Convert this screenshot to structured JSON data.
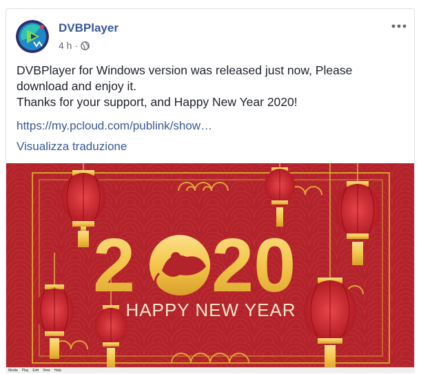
{
  "post": {
    "page_name": "DVBPlayer",
    "time": "4 h",
    "separator": "·",
    "privacy_icon": "globe-icon",
    "more_icon": "more-horizontal-icon",
    "text_lines": [
      "DVBPlayer for Windows version was released just now, Please",
      "download and enjoy it.",
      "Thanks for your support, and Happy New Year 2020!"
    ],
    "link": "https://my.pcloud.com/publink/show…",
    "translate": "Visualizza traduzione"
  },
  "banner": {
    "year_left": "2",
    "year_right": "20",
    "greeting": "HAPPY NEW YEAR",
    "background_color": "#b3232b",
    "gold_color": "#f3c64a"
  },
  "menubar": {
    "items": [
      "Media",
      "Play",
      "Edit",
      "View",
      "Help"
    ]
  },
  "colors": {
    "link": "#385898",
    "text": "#1d2129",
    "meta": "#616770"
  }
}
